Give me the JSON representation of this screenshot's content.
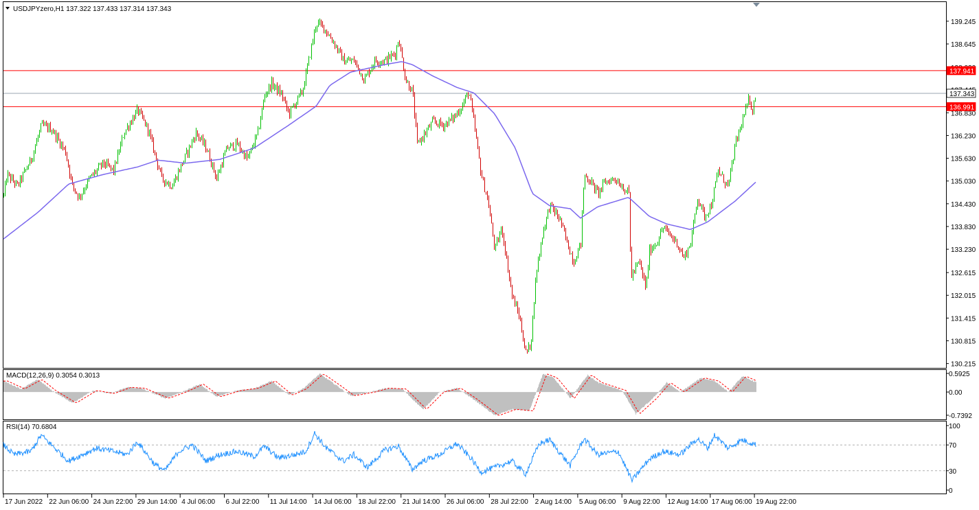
{
  "chart_data": {
    "type": "candlestick",
    "symbol_info": "USDJPYzero,H1  137.322 137.433 137.314 137.343",
    "last_price": "137.343",
    "price_ticks": [
      "139.245",
      "138.645",
      "138.030",
      "137.445",
      "136.830",
      "136.230",
      "135.630",
      "135.030",
      "134.430",
      "133.830",
      "133.230",
      "132.615",
      "132.015",
      "131.415",
      "130.815",
      "130.215"
    ],
    "ylim": [
      130.1,
      139.75
    ],
    "price_anchors": [
      [
        0,
        134.1
      ],
      [
        10,
        135.2
      ],
      [
        25,
        134.9
      ],
      [
        45,
        135.6
      ],
      [
        60,
        136.5
      ],
      [
        75,
        136.4
      ],
      [
        95,
        135.8
      ],
      [
        105,
        134.9
      ],
      [
        115,
        134.6
      ],
      [
        130,
        135.1
      ],
      [
        150,
        135.5
      ],
      [
        165,
        135.3
      ],
      [
        180,
        136.3
      ],
      [
        200,
        136.9
      ],
      [
        215,
        136.4
      ],
      [
        235,
        135.1
      ],
      [
        250,
        134.9
      ],
      [
        265,
        135.5
      ],
      [
        285,
        136.3
      ],
      [
        300,
        135.9
      ],
      [
        315,
        135.1
      ],
      [
        330,
        135.9
      ],
      [
        345,
        136.0
      ],
      [
        360,
        135.6
      ],
      [
        375,
        136.3
      ],
      [
        385,
        137.3
      ],
      [
        395,
        137.6
      ],
      [
        410,
        137.3
      ],
      [
        420,
        136.8
      ],
      [
        440,
        137.4
      ],
      [
        450,
        138.3
      ],
      [
        460,
        139.2
      ],
      [
        470,
        139.1
      ],
      [
        485,
        138.7
      ],
      [
        500,
        138.2
      ],
      [
        515,
        138.2
      ],
      [
        530,
        137.7
      ],
      [
        545,
        138.2
      ],
      [
        560,
        138.2
      ],
      [
        575,
        138.4
      ],
      [
        580,
        138.8
      ],
      [
        590,
        137.7
      ],
      [
        600,
        137.4
      ],
      [
        607,
        136.0
      ],
      [
        615,
        136.2
      ],
      [
        630,
        136.6
      ],
      [
        645,
        136.5
      ],
      [
        660,
        136.7
      ],
      [
        672,
        137.0
      ],
      [
        682,
        137.4
      ],
      [
        690,
        136.5
      ],
      [
        700,
        135.2
      ],
      [
        710,
        134.5
      ],
      [
        720,
        133.2
      ],
      [
        730,
        133.8
      ],
      [
        745,
        132.0
      ],
      [
        755,
        131.5
      ],
      [
        765,
        130.5
      ],
      [
        772,
        130.7
      ],
      [
        780,
        132.6
      ],
      [
        790,
        133.7
      ],
      [
        800,
        134.4
      ],
      [
        815,
        134.0
      ],
      [
        825,
        133.4
      ],
      [
        835,
        132.9
      ],
      [
        845,
        133.4
      ],
      [
        850,
        135.2
      ],
      [
        860,
        135.0
      ],
      [
        870,
        134.7
      ],
      [
        880,
        135.0
      ],
      [
        895,
        135.1
      ],
      [
        915,
        134.7
      ],
      [
        918,
        132.5
      ],
      [
        930,
        132.9
      ],
      [
        940,
        132.2
      ],
      [
        945,
        133.2
      ],
      [
        955,
        133.4
      ],
      [
        965,
        133.8
      ],
      [
        975,
        133.6
      ],
      [
        985,
        133.4
      ],
      [
        995,
        133.0
      ],
      [
        1005,
        133.4
      ],
      [
        1015,
        134.6
      ],
      [
        1025,
        134.1
      ],
      [
        1035,
        134.4
      ],
      [
        1045,
        135.3
      ],
      [
        1055,
        135.0
      ],
      [
        1060,
        134.9
      ],
      [
        1070,
        136.0
      ],
      [
        1080,
        136.6
      ],
      [
        1090,
        137.2
      ],
      [
        1095,
        136.9
      ],
      [
        1100,
        137.343
      ]
    ],
    "ma_anchors": [
      [
        5,
        133.5
      ],
      [
        55,
        134.2
      ],
      [
        100,
        134.95
      ],
      [
        150,
        135.2
      ],
      [
        200,
        135.4
      ],
      [
        230,
        135.58
      ],
      [
        270,
        135.5
      ],
      [
        320,
        135.6
      ],
      [
        370,
        135.9
      ],
      [
        420,
        136.5
      ],
      [
        460,
        137.0
      ],
      [
        480,
        137.55
      ],
      [
        510,
        137.9
      ],
      [
        560,
        138.1
      ],
      [
        585,
        138.18
      ],
      [
        600,
        138.1
      ],
      [
        630,
        137.8
      ],
      [
        665,
        137.5
      ],
      [
        690,
        137.35
      ],
      [
        720,
        136.8
      ],
      [
        750,
        135.9
      ],
      [
        775,
        134.7
      ],
      [
        800,
        134.38
      ],
      [
        830,
        134.3
      ],
      [
        845,
        134.05
      ],
      [
        870,
        134.35
      ],
      [
        915,
        134.6
      ],
      [
        945,
        134.1
      ],
      [
        970,
        133.9
      ],
      [
        1005,
        133.75
      ],
      [
        1030,
        133.95
      ],
      [
        1070,
        134.5
      ],
      [
        1100,
        135.0
      ]
    ],
    "hlines": [
      {
        "price": 137.941,
        "label": "137.941",
        "color": "#ff0000"
      },
      {
        "price": 137.343,
        "label": "137.343",
        "color": "#9aa4b0"
      },
      {
        "price": 136.991,
        "label": "136.991",
        "color": "#ff0000"
      }
    ],
    "macd": {
      "label": "MACD(12,26,9) 0.3054 0.3013",
      "ticks": [
        "0.5925",
        "0.00",
        "-0.7392"
      ],
      "ylim": [
        -0.85,
        0.68
      ],
      "anchors": [
        [
          5,
          0.35
        ],
        [
          30,
          0.1
        ],
        [
          55,
          0.4
        ],
        [
          75,
          0.05
        ],
        [
          105,
          -0.35
        ],
        [
          135,
          0.05
        ],
        [
          160,
          -0.05
        ],
        [
          185,
          0.15
        ],
        [
          205,
          0.12
        ],
        [
          240,
          -0.2
        ],
        [
          265,
          0.0
        ],
        [
          290,
          0.25
        ],
        [
          315,
          -0.15
        ],
        [
          345,
          0.05
        ],
        [
          370,
          0.12
        ],
        [
          395,
          0.35
        ],
        [
          420,
          -0.1
        ],
        [
          440,
          0.1
        ],
        [
          465,
          0.58
        ],
        [
          490,
          0.2
        ],
        [
          510,
          -0.12
        ],
        [
          540,
          0.0
        ],
        [
          560,
          0.12
        ],
        [
          585,
          0.1
        ],
        [
          615,
          -0.55
        ],
        [
          640,
          0.0
        ],
        [
          665,
          0.12
        ],
        [
          690,
          -0.25
        ],
        [
          720,
          -0.75
        ],
        [
          745,
          -0.55
        ],
        [
          770,
          -0.6
        ],
        [
          790,
          0.58
        ],
        [
          805,
          0.45
        ],
        [
          830,
          -0.2
        ],
        [
          855,
          0.55
        ],
        [
          870,
          0.3
        ],
        [
          905,
          0.05
        ],
        [
          925,
          -0.7
        ],
        [
          950,
          -0.2
        ],
        [
          970,
          0.3
        ],
        [
          990,
          0.0
        ],
        [
          1020,
          0.45
        ],
        [
          1040,
          0.35
        ],
        [
          1060,
          0.0
        ],
        [
          1080,
          0.5
        ],
        [
          1100,
          0.31
        ]
      ]
    },
    "rsi": {
      "label": "RSI(14) 70.6804",
      "ticks": [
        "100",
        "70",
        "30",
        "0"
      ],
      "ylim": [
        0,
        100
      ],
      "levels": [
        70,
        30
      ],
      "anchors": [
        [
          5,
          70
        ],
        [
          20,
          55
        ],
        [
          45,
          60
        ],
        [
          60,
          85
        ],
        [
          80,
          65
        ],
        [
          100,
          45
        ],
        [
          120,
          55
        ],
        [
          140,
          65
        ],
        [
          165,
          60
        ],
        [
          185,
          55
        ],
        [
          200,
          75
        ],
        [
          225,
          40
        ],
        [
          240,
          30
        ],
        [
          260,
          60
        ],
        [
          280,
          70
        ],
        [
          300,
          45
        ],
        [
          320,
          55
        ],
        [
          345,
          60
        ],
        [
          370,
          52
        ],
        [
          385,
          68
        ],
        [
          405,
          50
        ],
        [
          430,
          55
        ],
        [
          445,
          60
        ],
        [
          458,
          88
        ],
        [
          475,
          65
        ],
        [
          500,
          45
        ],
        [
          515,
          55
        ],
        [
          535,
          35
        ],
        [
          560,
          62
        ],
        [
          580,
          68
        ],
        [
          600,
          32
        ],
        [
          615,
          45
        ],
        [
          640,
          55
        ],
        [
          665,
          72
        ],
        [
          685,
          50
        ],
        [
          700,
          28
        ],
        [
          720,
          35
        ],
        [
          745,
          45
        ],
        [
          765,
          25
        ],
        [
          785,
          72
        ],
        [
          800,
          78
        ],
        [
          830,
          38
        ],
        [
          850,
          80
        ],
        [
          870,
          55
        ],
        [
          900,
          60
        ],
        [
          920,
          15
        ],
        [
          945,
          48
        ],
        [
          965,
          60
        ],
        [
          990,
          55
        ],
        [
          1015,
          80
        ],
        [
          1030,
          65
        ],
        [
          1040,
          85
        ],
        [
          1060,
          65
        ],
        [
          1080,
          78
        ],
        [
          1100,
          70.68
        ]
      ]
    },
    "x_ticks": [
      "17 Jun 2022",
      "22 Jun 06:00",
      "24 Jun 22:00",
      "29 Jun 14:00",
      "4 Jul 06:00",
      "6 Jul 22:00",
      "11 Jul 14:00",
      "14 Jul 06:00",
      "18 Jul 22:00",
      "21 Jul 14:00",
      "26 Jul 06:00",
      "28 Jul 22:00",
      "2 Aug 14:00",
      "5 Aug 06:00",
      "9 Aug 22:00",
      "12 Aug 14:00",
      "17 Aug 06:00",
      "19 Aug 22:00"
    ],
    "colors": {
      "up": "#00c000",
      "down": "#d00000",
      "wick": "#000000",
      "ma": "#7b68ee",
      "macd_hist": "#c0c0c0",
      "macd_signal": "#ff0000",
      "rsi_line": "#1e90ff",
      "hline_red": "#ff0000",
      "hline_gray": "#9aa4b0"
    }
  }
}
